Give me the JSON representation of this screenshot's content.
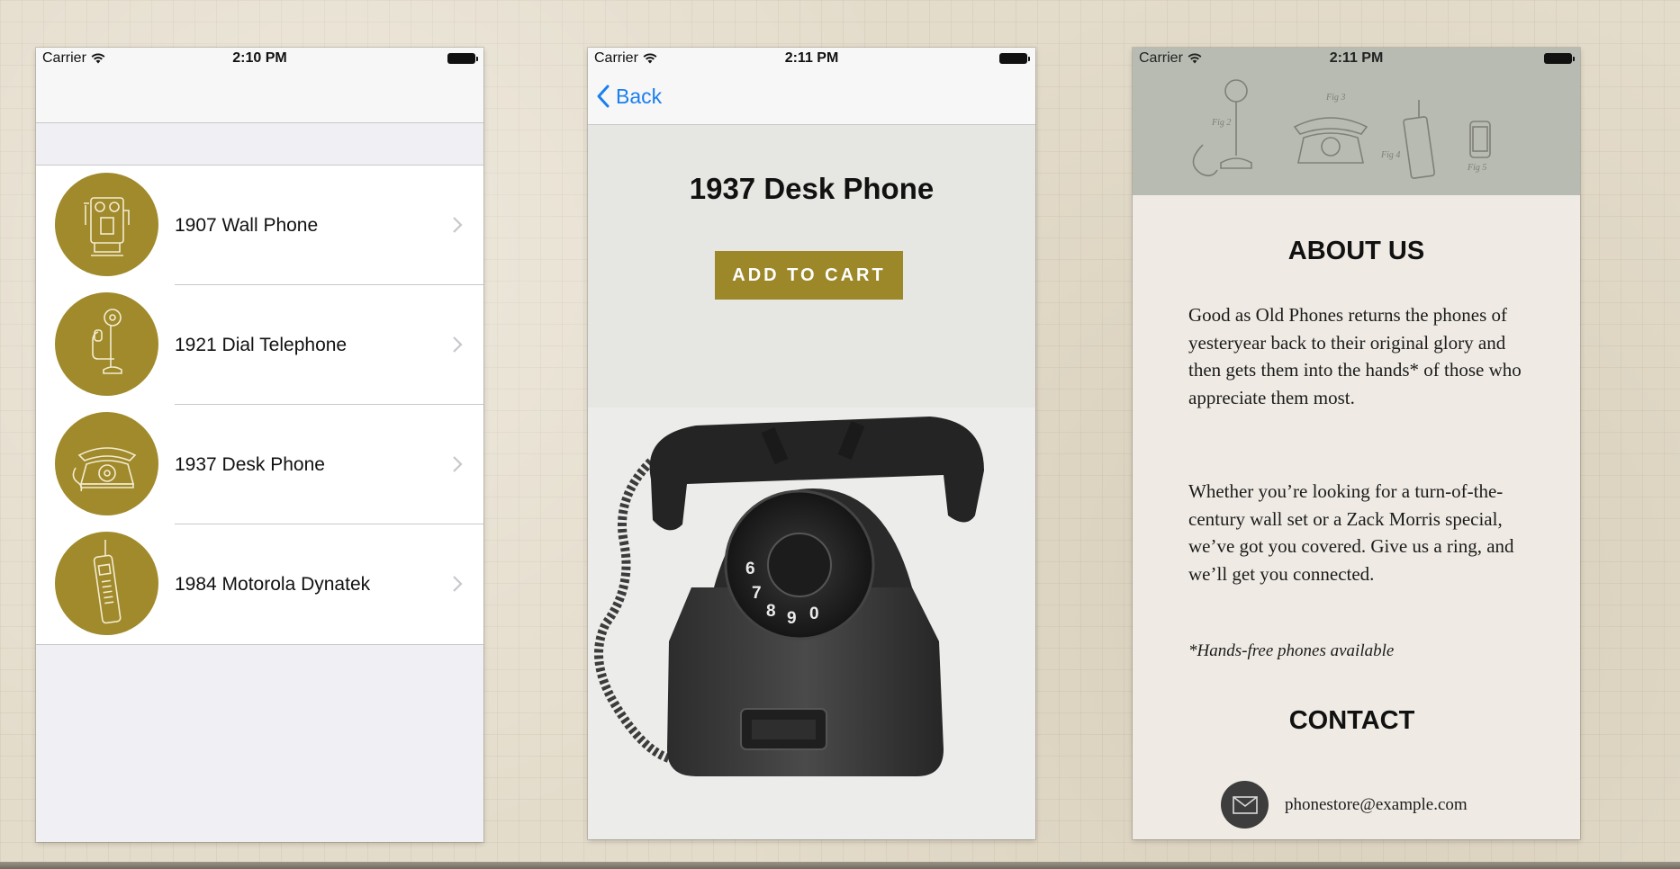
{
  "screens": [
    {
      "status": {
        "carrier": "Carrier",
        "time": "2:10 PM"
      },
      "products": [
        {
          "name": "1907 Wall Phone",
          "icon": "wall-phone-icon"
        },
        {
          "name": "1921 Dial Telephone",
          "icon": "candlestick-phone-icon"
        },
        {
          "name": "1937 Desk Phone",
          "icon": "desk-phone-icon"
        },
        {
          "name": "1984 Motorola Dynatek",
          "icon": "mobile-phone-icon"
        }
      ]
    },
    {
      "status": {
        "carrier": "Carrier",
        "time": "2:11 PM"
      },
      "back_label": "Back",
      "product_title": "1937 Desk Phone",
      "add_to_cart_label": "ADD TO CART",
      "photo": "rotary-desk-phone-photo"
    },
    {
      "status": {
        "carrier": "Carrier",
        "time": "2:11 PM"
      },
      "banner": {
        "labels": [
          "Fig 2",
          "Fig 3",
          "Fig 4",
          "Fig 5"
        ]
      },
      "about_title": "ABOUT US",
      "about_p1": "Good as Old Phones returns the phones of yesteryear back to their original glory and then gets them into the hands* of those who appreciate them most.",
      "about_p2": "Whether you’re looking for a turn-of-the-century wall set or a Zack Morris special, we’ve got you covered. Give us a ring, and we’ll get you connected.",
      "footnote": "*Hands-free phones available",
      "contact_title": "CONTACT",
      "email": "phonestore@example.com"
    }
  ],
  "colors": {
    "accent": "#9c8729",
    "link": "#1a7ff0",
    "mail_circle": "#3d3d3d",
    "background": "#e4dccb"
  }
}
